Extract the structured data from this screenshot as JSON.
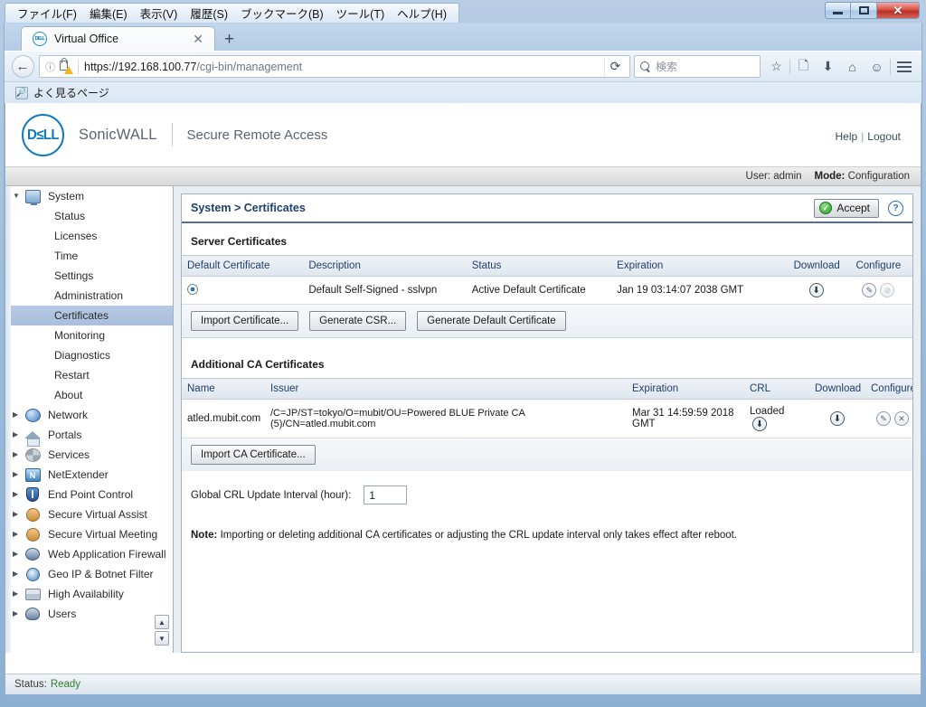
{
  "browser": {
    "menus": [
      {
        "label": "ファイル(F)",
        "accel": "F"
      },
      {
        "label": "編集(E)",
        "accel": "E"
      },
      {
        "label": "表示(V)",
        "accel": "V"
      },
      {
        "label": "履歴(S)",
        "accel": "S"
      },
      {
        "label": "ブックマーク(B)",
        "accel": "B"
      },
      {
        "label": "ツール(T)",
        "accel": "T"
      },
      {
        "label": "ヘルプ(H)",
        "accel": "H"
      }
    ],
    "window_controls": {
      "minimize": "minimize-button",
      "maximize": "maximize-button",
      "close": "✕"
    },
    "tab": {
      "title": "Virtual Office",
      "favicon": "dell-favicon",
      "close": "✕"
    },
    "new_tab": "+",
    "back": "←",
    "url_scheme": "https://192.168.100.77",
    "url_path": "/cgi-bin/management",
    "reload": "⟳",
    "search_placeholder": "検索",
    "bookmark": {
      "label": "よく見るページ",
      "icon": "bookmark-folder-icon"
    },
    "toolbar_icons": [
      "star-icon",
      "reader-icon",
      "downloads-icon",
      "home-icon",
      "sync-icon",
      "menu-icon"
    ]
  },
  "brand": {
    "logo_text": "D≤LL",
    "company": "SonicWALL",
    "product": "Secure Remote Access",
    "help": "Help",
    "separator": "|",
    "logout": "Logout"
  },
  "userstrip": {
    "user_label": "User:",
    "user_value": "admin",
    "mode_label": "Mode:",
    "mode_value": "Configuration"
  },
  "sidebar": {
    "groups": [
      {
        "label": "System",
        "icon": "monitor-icon",
        "expanded": true,
        "twisty": "▼",
        "children": [
          "Status",
          "Licenses",
          "Time",
          "Settings",
          "Administration",
          "Certificates",
          "Monitoring",
          "Diagnostics",
          "Restart",
          "About"
        ],
        "selected_child": "Certificates"
      },
      {
        "label": "Network",
        "icon": "globe-icon",
        "expanded": false,
        "twisty": "▶",
        "children": []
      },
      {
        "label": "Portals",
        "icon": "portal-icon",
        "expanded": false,
        "twisty": "▶",
        "children": []
      },
      {
        "label": "Services",
        "icon": "gear-icon",
        "expanded": false,
        "twisty": "▶",
        "children": []
      },
      {
        "label": "NetExtender",
        "icon": "netextender-icon",
        "expanded": false,
        "twisty": "▶",
        "children": []
      },
      {
        "label": "End Point Control",
        "icon": "shield-icon",
        "expanded": false,
        "twisty": "▶",
        "children": []
      },
      {
        "label": "Secure Virtual Assist",
        "icon": "headset-user-icon",
        "expanded": false,
        "twisty": "▶",
        "children": []
      },
      {
        "label": "Secure Virtual Meeting",
        "icon": "users-meeting-icon",
        "expanded": false,
        "twisty": "▶",
        "children": []
      },
      {
        "label": "Web Application Firewall",
        "icon": "firewall-icon",
        "expanded": false,
        "twisty": "▶",
        "children": []
      },
      {
        "label": "Geo IP & Botnet Filter",
        "icon": "geo-filter-icon",
        "expanded": false,
        "twisty": "▶",
        "children": []
      },
      {
        "label": "High Availability",
        "icon": "servers-icon",
        "expanded": false,
        "twisty": "▶",
        "children": []
      },
      {
        "label": "Users",
        "icon": "users-icon",
        "expanded": false,
        "twisty": "▶",
        "children": []
      }
    ],
    "scroll_up": "▲",
    "scroll_down": "▼"
  },
  "page": {
    "title": "System > Certificates",
    "accept_button": "Accept",
    "help_icon": "?",
    "server_section_title": "Server Certificates",
    "server_columns": [
      "Default Certificate",
      "Description",
      "Status",
      "Expiration",
      "Download",
      "Configure"
    ],
    "server_rows": [
      {
        "default_selected": true,
        "description": "Default Self-Signed - sslvpn",
        "status": "Active Default Certificate",
        "expiration": "Jan 19 03:14:07 2038 GMT",
        "download": "⬇",
        "configure_edit": "✎",
        "configure_delete": "⊘"
      }
    ],
    "server_buttons": [
      "Import Certificate...",
      "Generate CSR...",
      "Generate Default Certificate"
    ],
    "ca_section_title": "Additional CA Certificates",
    "ca_columns": [
      "Name",
      "Issuer",
      "Expiration",
      "CRL",
      "Download",
      "Configure"
    ],
    "ca_rows": [
      {
        "name": "atled.mubit.com",
        "issuer": "/C=JP/ST=tokyo/O=mubit/OU=Powered BLUE Private CA (5)/CN=atled.mubit.com",
        "expiration": "Mar 31 14:59:59 2018 GMT",
        "crl_status": "Loaded",
        "crl_download": "⬇",
        "download": "⬇",
        "configure_edit": "✎",
        "configure_delete": "✕"
      }
    ],
    "ca_buttons": [
      "Import CA Certificate..."
    ],
    "crl_label": "Global CRL Update Interval (hour):",
    "crl_value": "1",
    "note_label": "Note:",
    "note_text": " Importing or deleting additional CA certificates or adjusting the CRL update interval only takes effect after reboot."
  },
  "statusbar": {
    "label": "Status:",
    "value": "Ready"
  },
  "colors": {
    "accent_blue": "#1f3f6b",
    "dell_blue": "#0f7ac0",
    "selection": "#b6c9e4",
    "status_ok": "#2f7d32"
  }
}
